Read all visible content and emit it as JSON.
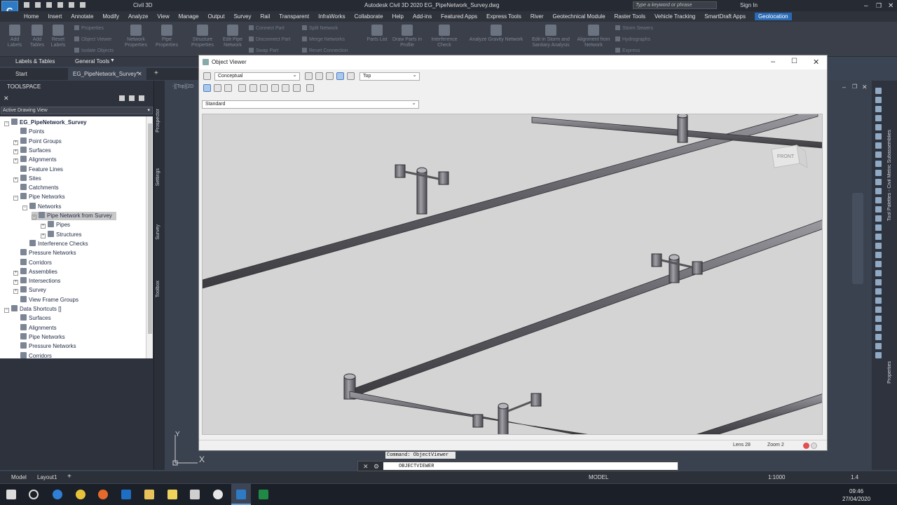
{
  "titlebar": {
    "app_badge": "Civil 3D",
    "search_placeholder": "Type a keyword or phrase",
    "title": "Autodesk Civil 3D 2020   EG_PipeNetwork_Survey.dwg",
    "sign_in": "Sign In"
  },
  "menu": [
    "Home",
    "Insert",
    "Annotate",
    "Modify",
    "Analyze",
    "View",
    "Manage",
    "Output",
    "Survey",
    "Rail",
    "Transparent",
    "InfraWorks",
    "Collaborate",
    "Help",
    "Add-ins",
    "Featured Apps",
    "Express Tools",
    "River",
    "Geotechnical Module",
    "Raster Tools",
    "Vehicle Tracking",
    "SmartDraft Apps",
    "Geolocation"
  ],
  "ribbon": {
    "add_labels": "Add Labels",
    "add_tables": "Add Tables",
    "reset_labels": "Reset Labels",
    "properties": "Properties",
    "object_viewer": "Object Viewer",
    "isolate_objects": "Isolate Objects",
    "network_properties": "Network Properties",
    "pipe_properties": "Pipe Properties",
    "structure_properties": "Structure Properties",
    "edit_pipe_network": "Edit Pipe Network",
    "connect_part": "Connect Part",
    "disconnect_part": "Disconnect Part",
    "swap_part": "Swap Part",
    "split_network": "Split Network",
    "merge_networks": "Merge Networks",
    "reset_connection": "Reset Connection",
    "parts_list": "Parts List",
    "draw_parts_in_profile": "Draw Parts in Profile",
    "interference_check": "Interference Check",
    "analyze_gravity_network": "Analyze Gravity Network",
    "edit_in_storm": "Edit in Storm and Sanitary Analysis",
    "alignment_from_network": "Alignment from Network",
    "storm_sewers": "Storm Sewers",
    "hydrographs": "Hydrographs",
    "express": "Express",
    "panel_labels_tables": "Labels & Tables",
    "panel_general_tools": "General Tools"
  },
  "doc_tabs": {
    "start": "Start",
    "active": "EG_PipeNetwork_Survey*"
  },
  "toolspace": {
    "title": "TOOLSPACE",
    "view_select": "Active Drawing View",
    "vertical_tabs": [
      "Prospector",
      "Settings",
      "Survey",
      "Toolbox"
    ],
    "tree": [
      {
        "label": "EG_PipeNetwork_Survey",
        "indent": 0,
        "exp": "-",
        "bold": true
      },
      {
        "label": "Point Groups",
        "indent": 1,
        "exp": "+"
      },
      {
        "label": "Points",
        "indent": 1,
        "exp": ""
      },
      {
        "label": "Surfaces",
        "indent": 1,
        "exp": "+"
      },
      {
        "label": "Alignments",
        "indent": 1,
        "exp": "+"
      },
      {
        "label": "Feature Lines",
        "indent": 1,
        "exp": ""
      },
      {
        "label": "Sites",
        "indent": 1,
        "exp": "+"
      },
      {
        "label": "Catchments",
        "indent": 1,
        "exp": ""
      },
      {
        "label": "Pipe Networks",
        "indent": 1,
        "exp": "-"
      },
      {
        "label": "Networks",
        "indent": 2,
        "exp": "-"
      },
      {
        "label": "Pipe Network from Survey",
        "indent": 3,
        "exp": "-",
        "selected": true
      },
      {
        "label": "Pipes",
        "indent": 4,
        "exp": "+"
      },
      {
        "label": "Structures",
        "indent": 4,
        "exp": "+"
      },
      {
        "label": "Interference Checks",
        "indent": 2,
        "exp": ""
      },
      {
        "label": "Pressure Networks",
        "indent": 1,
        "exp": ""
      },
      {
        "label": "Corridors",
        "indent": 1,
        "exp": ""
      },
      {
        "label": "Assemblies",
        "indent": 1,
        "exp": "+"
      },
      {
        "label": "Intersections",
        "indent": 1,
        "exp": "+"
      },
      {
        "label": "Survey",
        "indent": 1,
        "exp": "+"
      },
      {
        "label": "View Frame Groups",
        "indent": 1,
        "exp": ""
      },
      {
        "label": "Data Shortcuts []",
        "indent": 0,
        "exp": "-"
      },
      {
        "label": "Surfaces",
        "indent": 1,
        "exp": ""
      },
      {
        "label": "Alignments",
        "indent": 1,
        "exp": ""
      },
      {
        "label": "Pipe Networks",
        "indent": 1,
        "exp": ""
      },
      {
        "label": "Pressure Networks",
        "indent": 1,
        "exp": ""
      },
      {
        "label": "Corridors",
        "indent": 1,
        "exp": ""
      }
    ]
  },
  "viewport_label": "-][Top][2D",
  "object_viewer": {
    "title": "Object Viewer",
    "visual_style": "Conceptual",
    "view": "Top",
    "preset": "Standard",
    "viewcube_label": "FRONT",
    "lens": "Lens 28",
    "zoom": "Zoom 2"
  },
  "command": {
    "tooltip": "Command: ObjectViewer",
    "input": "OBJECTVIEWER"
  },
  "ucs": {
    "y": "Y",
    "x": "X"
  },
  "layout_tabs": [
    "Model",
    "Layout1"
  ],
  "status": {
    "model": "MODEL",
    "scale": "1:1000",
    "precision": "1.4",
    "time": "09:46",
    "date": "27/04/2020"
  },
  "right_palette": [
    "Tool Palettes - Civil Metric Subassemblies",
    "Properties"
  ]
}
